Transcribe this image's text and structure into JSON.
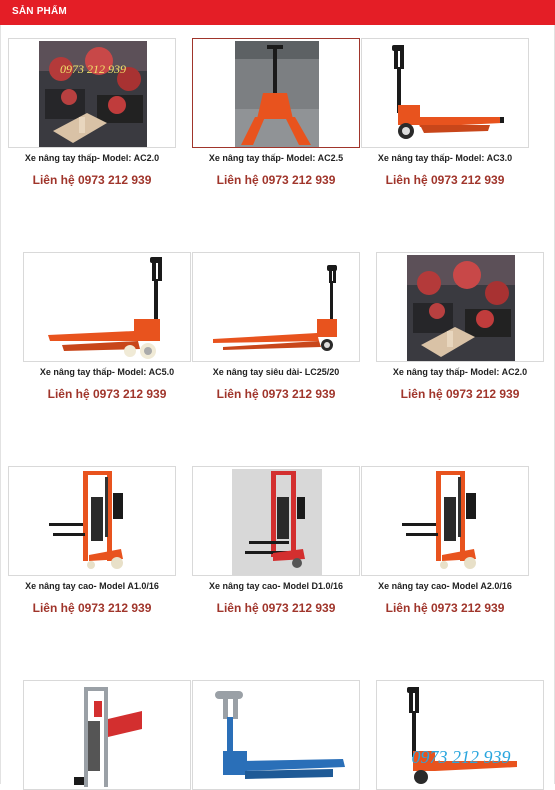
{
  "section": {
    "title": "SẢN PHẨM"
  },
  "products": [
    {
      "name": "Xe nâng tay thấp- Model: AC2.0",
      "price": "Liên hệ 0973 212 939",
      "image": "warehouse-photo",
      "watermark": "0973 212 939"
    },
    {
      "name": "Xe nâng tay thấp- Model: AC2.5",
      "price": "Liên hệ 0973 212 939",
      "image": "orange-pallet-truck-photo"
    },
    {
      "name": "Xe nâng tay thấp- Model: AC3.0",
      "price": "Liên hệ 0973 212 939",
      "image": "pallet-truck-side"
    },
    {
      "name": "Xe nâng tay thấp- Model: AC5.0",
      "price": "Liên hệ 0973 212 939",
      "image": "pallet-truck-side"
    },
    {
      "name": "Xe nâng tay siêu dài- LC25/20",
      "price": "Liên hệ 0973 212 939",
      "image": "long-pallet-truck"
    },
    {
      "name": "Xe nâng tay thấp- Model: AC2.0",
      "price": "Liên hệ 0973 212 939",
      "image": "warehouse-photo"
    },
    {
      "name": "Xe nâng tay cao- Model A1.0/16",
      "price": "Liên hệ 0973 212 939",
      "image": "orange-stacker"
    },
    {
      "name": "Xe nâng tay cao- Model D1.0/16",
      "price": "Liên hệ 0973 212 939",
      "image": "red-stacker-grey-bg"
    },
    {
      "name": "Xe nâng tay cao- Model A2.0/16",
      "price": "Liên hệ 0973 212 939",
      "image": "orange-stacker"
    },
    {
      "name": "",
      "price": "",
      "image": "table-lift"
    },
    {
      "name": "",
      "price": "",
      "image": "blue-pallet-truck"
    },
    {
      "name": "",
      "price": "",
      "image": "pallet-truck-watermark",
      "watermark": "0973 212 939"
    }
  ],
  "colors": {
    "header": "#e41e26",
    "price": "#a0352b",
    "orange": "#e8531e",
    "blue": "#2a6fb8"
  }
}
